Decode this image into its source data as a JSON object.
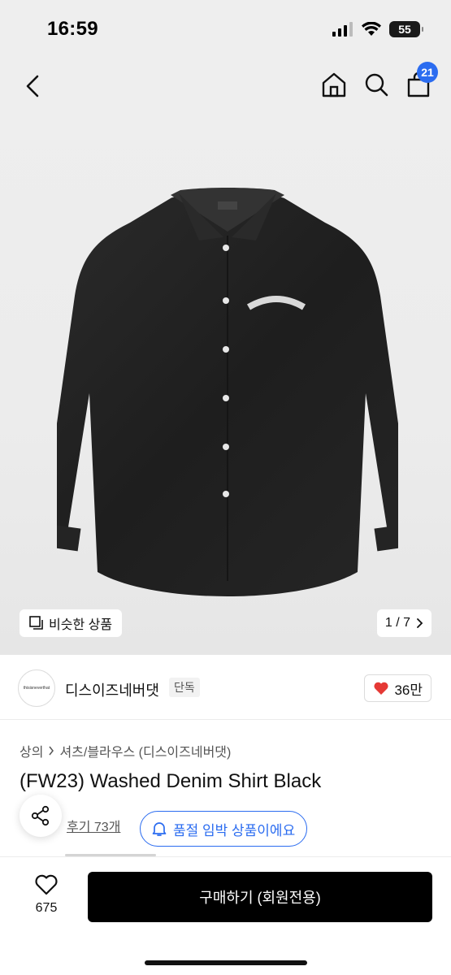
{
  "status_bar": {
    "time": "16:59",
    "battery": "55"
  },
  "header": {
    "cart_count": "21"
  },
  "hero": {
    "shirt_logo_text": "THISISNEVERTHAT",
    "similar_label": "비슷한 상품",
    "image_counter": "1 / 7"
  },
  "brand": {
    "logo_text": "thisisneverthat",
    "name": "디스이즈네버댓",
    "tag": "단독",
    "likes": "36만"
  },
  "product": {
    "breadcrumb": [
      "상의",
      "셔츠/블라우스 (디스이즈네버댓)"
    ],
    "title": "(FW23) Washed Denim Shirt Black",
    "review_label": "후기 73개",
    "stock_alert": "품절 임박 상품이에요"
  },
  "bottom_bar": {
    "wish_count": "675",
    "buy_label": "구매하기 (회원전용)"
  },
  "colors": {
    "accent": "#2b6cf0",
    "like": "#e53935",
    "buy_bg": "#000000"
  }
}
